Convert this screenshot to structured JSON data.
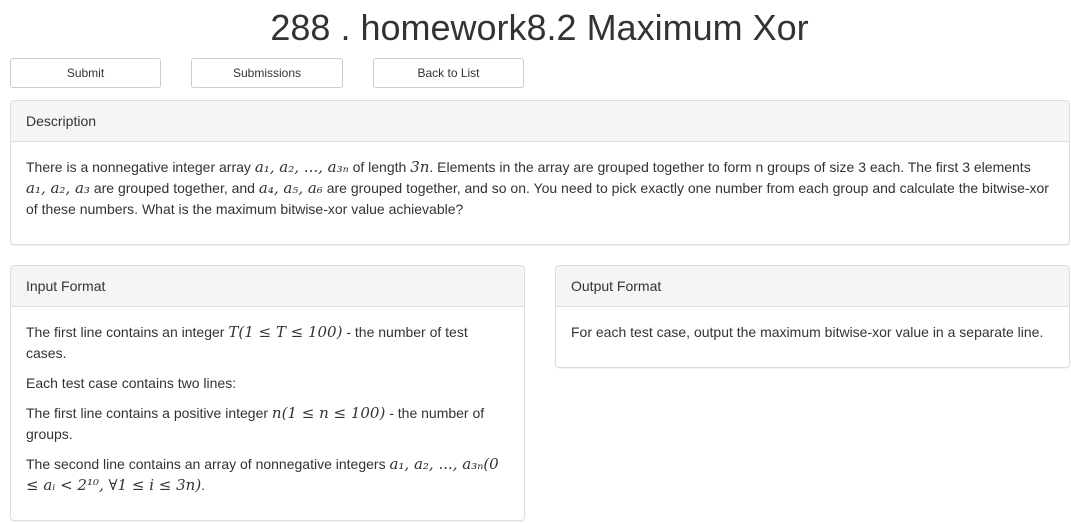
{
  "problem": {
    "title": "288 . homework8.2 Maximum Xor"
  },
  "toolbar": {
    "submit_label": "Submit",
    "submissions_label": "Submissions",
    "back_label": "Back to List"
  },
  "description": {
    "heading": "Description",
    "t1": "There is a nonnegative integer array ",
    "m_arr": "a₁, a₂, ..., a₃ₙ",
    "t2": " of length ",
    "m_len": "3n",
    "t3": ". Elements in the array are grouped together to form n groups of size 3 each. The first 3 elements ",
    "m_g1": "a₁, a₂, a₃",
    "t4": " are grouped together, and ",
    "m_g2": "a₄, a₅, a₆",
    "t5": " are grouped together, and so on. You need to pick exactly one number from each group and calculate the bitwise-xor of these numbers. What is the maximum bitwise-xor value achievable?"
  },
  "input_format": {
    "heading": "Input Format",
    "p1_a": "The first line contains an integer ",
    "p1_math": "T(1 ≤ T ≤ 100)",
    "p1_b": " - the number of test cases.",
    "p2": "Each test case contains two lines:",
    "p3_a": "The first line contains a positive integer ",
    "p3_math": "n(1 ≤ n ≤ 100)",
    "p3_b": " - the number of groups.",
    "p4_a": "The second line contains an array of nonnegative integers ",
    "p4_math": "a₁, a₂, ..., a₃ₙ(0 ≤ aᵢ < 2¹⁰, ∀1 ≤ i ≤ 3n)",
    "p4_b": "."
  },
  "output_format": {
    "heading": "Output Format",
    "text": "For each test case, output the maximum bitwise-xor value in a separate line."
  }
}
